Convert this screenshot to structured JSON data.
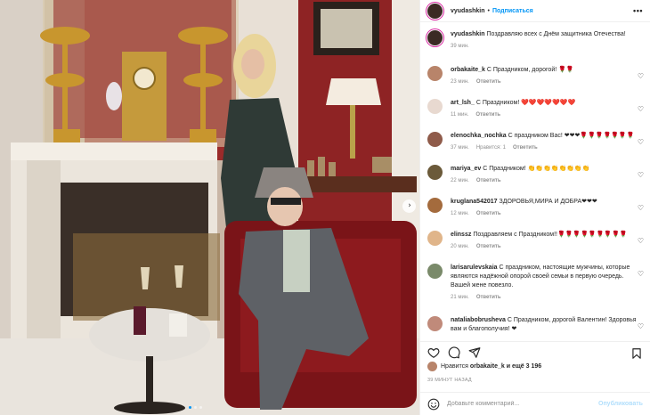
{
  "post": {
    "username": "vyudashkin",
    "follow_label": "Подписаться",
    "more_label": "•••",
    "caption": {
      "username": "vyudashkin",
      "text": "Поздравляю всех с Днём защитника Отечества!",
      "time": "39 мин."
    }
  },
  "comments": [
    {
      "username": "orbakaite_k",
      "text": "С Праздником, дорогой! 🌹🌹",
      "time": "23 мин.",
      "reply": "Ответить",
      "likes": "",
      "avatar_color": "#b8846a"
    },
    {
      "username": "art_lsh_",
      "text": "С Праздником! ❤️❤️❤️❤️❤️❤️❤️",
      "time": "11 мин.",
      "reply": "Ответить",
      "likes": "",
      "avatar_color": "#e8d9d0"
    },
    {
      "username": "elenochka_nochka",
      "text": "С праздником Вас! ❤❤❤🌹🌹🌹🌹🌹🌹🌹",
      "time": "37 мин.",
      "reply": "Ответить",
      "likes": "Нравится: 1",
      "avatar_color": "#8f5b4a"
    },
    {
      "username": "mariya_ev",
      "text": "С Праздником! 👏👏👏👏👏👏👏👏",
      "time": "22 мин.",
      "reply": "Ответить",
      "likes": "",
      "avatar_color": "#6b5a3a"
    },
    {
      "username": "kruglana542017",
      "text": "ЗДОРОВЬЯ,МИРА И ДОБРА❤❤❤",
      "time": "12 мин.",
      "reply": "Ответить",
      "likes": "",
      "avatar_color": "#a46b3d"
    },
    {
      "username": "elinssz",
      "text": "Поздравляем с Праздником!!🌹🌹🌹🌹🌹🌹🌹🌹🌹",
      "time": "20 мин.",
      "reply": "Ответить",
      "likes": "",
      "avatar_color": "#e0b58a"
    },
    {
      "username": "larisarulevskaia",
      "text": "С праздником, настоящие мужчины, которые являются надёжной опорой своей семьи в первую очередь. Вашей жене повезло.",
      "time": "21 мин.",
      "reply": "Ответить",
      "likes": "",
      "avatar_color": "#7a8a6a"
    },
    {
      "username": "nataliabobrusheva",
      "text": "С Праздником, дорогой Валентин! Здоровья вам и благополучия! ❤",
      "time": "",
      "reply": "",
      "likes": "",
      "avatar_color": "#c08a7a"
    }
  ],
  "likes_row": {
    "prefix": "Нравится",
    "user": "orbakaite_k",
    "suffix": "и ещё 3 196"
  },
  "timestamp": "39 МИНУТ НАЗАД",
  "add_comment": {
    "placeholder": "Добавьте комментарий...",
    "publish_label": "Опубликовать"
  },
  "icons": {
    "heart": "heart-icon",
    "comment": "comment-icon",
    "share": "share-icon",
    "save": "bookmark-icon",
    "emoji": "smile-icon",
    "next": "chevron-right-icon"
  },
  "colors": {
    "link_blue": "#0095f6",
    "publish_disabled": "#b2dffc",
    "muted": "#8e8e8e",
    "text": "#262626"
  }
}
